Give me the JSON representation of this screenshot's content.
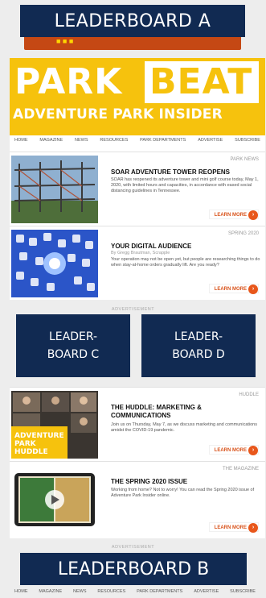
{
  "placeholders": {
    "leaderboard_a": "LEADERBOARD A",
    "leaderboard_b": "LEADERBOARD B",
    "leaderboard_c": "LEADER-BOARD C",
    "leaderboard_d": "LEADER-BOARD D"
  },
  "masthead": {
    "word1": "PARK",
    "word2": "BEAT",
    "tagline": "ADVENTURE PARK INSIDER",
    "brand_color": "#f6c20d"
  },
  "nav": [
    "HOME",
    "MAGAZINE",
    "NEWS",
    "RESOURCES",
    "PARK DEPARTMENTS",
    "ADVERTISE",
    "SUBSCRIBE"
  ],
  "articles": [
    {
      "tag": "PARK NEWS",
      "title": "SOAR ADVENTURE TOWER REOPENS",
      "byline": "",
      "body": "SOAR has reopened its adventure tower and mini golf course today, May 1, 2020, with limited hours and capacities, in accordance with eased social distancing guidelines in Tennessee.",
      "more": "LEARN MORE"
    },
    {
      "tag": "SPRING 2020",
      "title": "YOUR DIGITAL AUDIENCE",
      "byline": "By Gregg Brautman, Scrapple",
      "body": "Your operation may not be open yet, but people are researching things to do when stay-at-home orders gradually lift. Are you ready?",
      "more": "LEARN MORE"
    },
    {
      "tag": "HUDDLE",
      "title": "THE HUDDLE: MARKETING & COMMUNICATIONS",
      "byline": "",
      "body": "Join us on Thursday, May 7, as we discuss marketing and communications amidst the COVID-19 pandemic.",
      "more": "LEARN MORE"
    },
    {
      "tag": "THE MAGAZINE",
      "title": "THE SPRING 2020 ISSUE",
      "byline": "",
      "body": "Working from home? Not to worry! You can read the Spring 2020 issue of Adventure Park Insider online.",
      "more": "LEARN MORE"
    }
  ],
  "ad_label": "ADVERTISEMENT"
}
